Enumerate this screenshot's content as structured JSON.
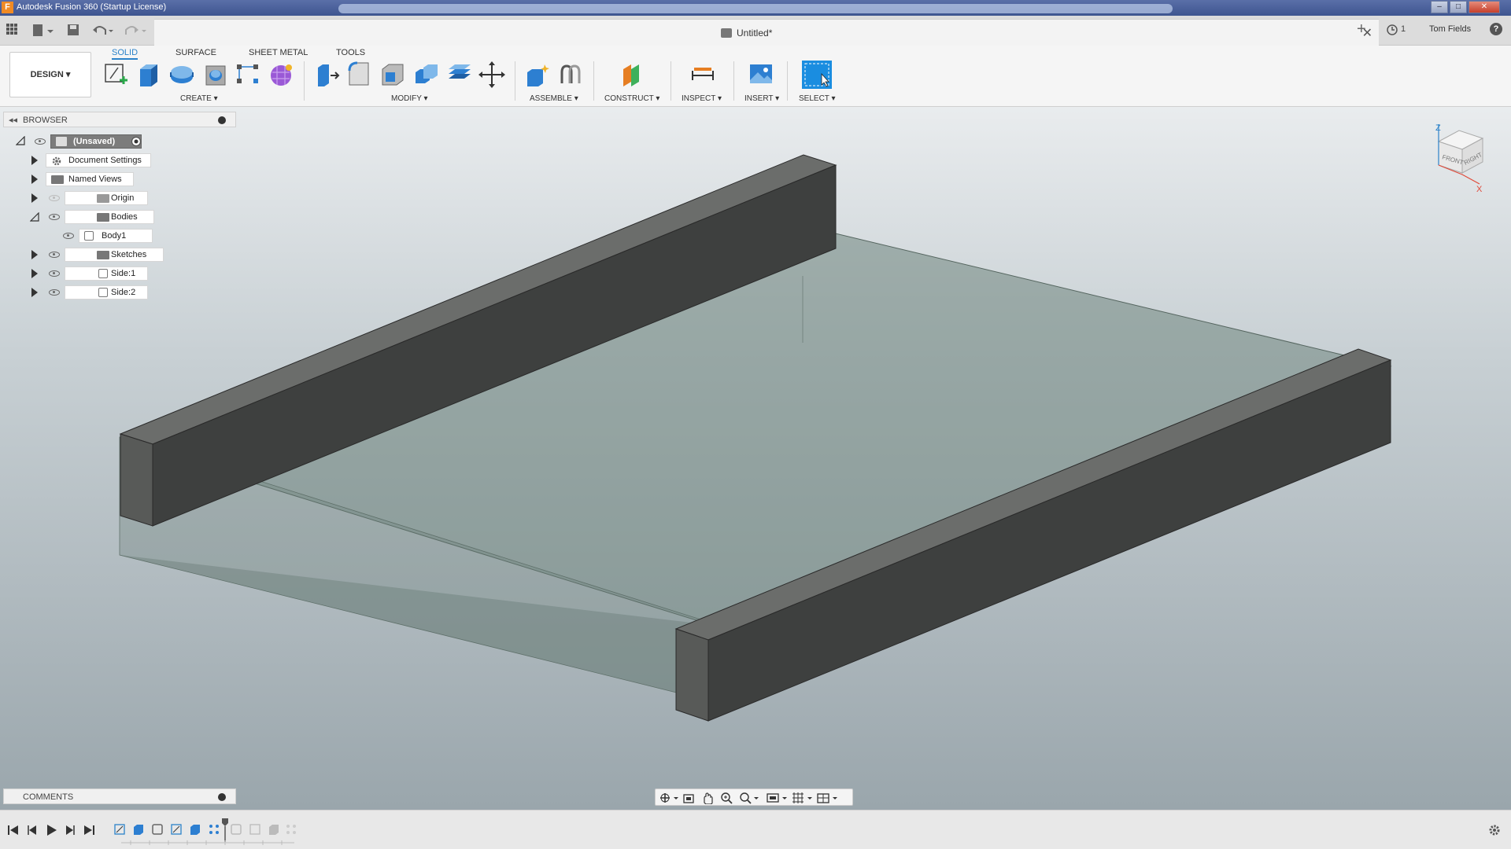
{
  "window": {
    "title": "Autodesk Fusion 360 (Startup License)",
    "app_icon_letter": "F",
    "min_glyph": "–",
    "max_glyph": "□",
    "close_glyph": "✕"
  },
  "tabbar": {
    "document_name": "Untitled*",
    "close_glyph": "✕",
    "new_tab_glyph": "+",
    "jobs_count": "1",
    "user_name": "Tom Fields",
    "help_glyph": "?"
  },
  "ribbon": {
    "tabs": [
      "SOLID",
      "SURFACE",
      "SHEET METAL",
      "TOOLS"
    ],
    "active_tab": "SOLID",
    "workspace": "DESIGN ▾",
    "groups": {
      "create": "CREATE ▾",
      "modify": "MODIFY ▾",
      "assemble": "ASSEMBLE ▾",
      "construct": "CONSTRUCT ▾",
      "inspect": "INSPECT ▾",
      "insert": "INSERT ▾",
      "select": "SELECT ▾"
    }
  },
  "browser": {
    "title": "BROWSER",
    "root": "(Unsaved)",
    "items": [
      {
        "label": "Document Settings",
        "icon": "gear-icon",
        "visible": false
      },
      {
        "label": "Named Views",
        "icon": "folder-icon",
        "visible": false
      },
      {
        "label": "Origin",
        "icon": "folder-icon",
        "visible": "faded"
      },
      {
        "label": "Bodies",
        "icon": "folder-icon",
        "visible": true,
        "expanded": true
      },
      {
        "label": "Body1",
        "icon": "body-icon",
        "visible": true
      },
      {
        "label": "Sketches",
        "icon": "folder-icon",
        "visible": true
      },
      {
        "label": "Side:1",
        "icon": "component-icon",
        "visible": true
      },
      {
        "label": "Side:2",
        "icon": "component-icon",
        "visible": true
      }
    ]
  },
  "viewcube": {
    "z_label": "Z",
    "x_label": "X",
    "front_label": "FRONT",
    "right_label": "RIGHT"
  },
  "comments": {
    "title": "COMMENTS"
  },
  "colors": {
    "accent": "#2b82c9",
    "viewport_top": "#e9ecee",
    "viewport_bottom": "#9aa6ac",
    "rail_dark": "#3e403f",
    "rail_top": "#6b6d6b",
    "plate": "#6f857e"
  }
}
